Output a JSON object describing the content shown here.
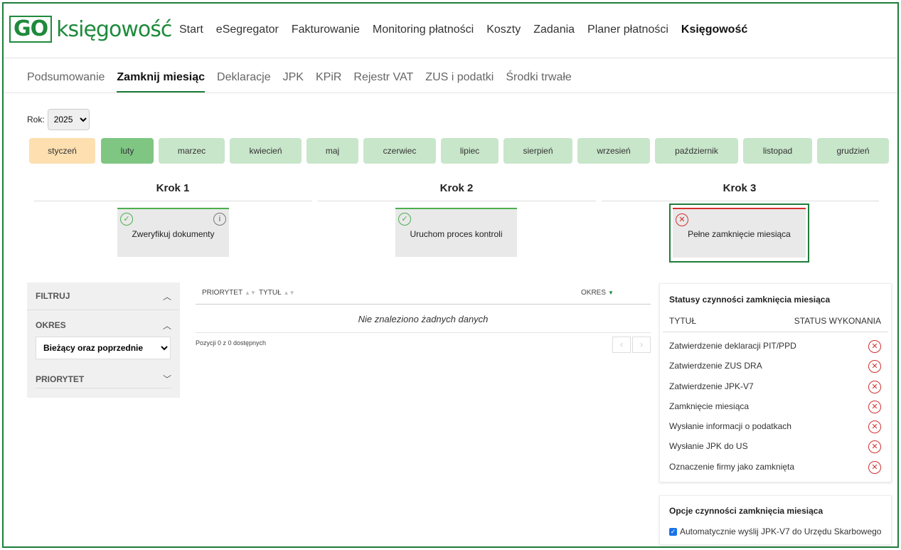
{
  "logo": {
    "box": "GO",
    "text": "księgowość"
  },
  "main_nav": [
    "Start",
    "eSegregator",
    "Fakturowanie",
    "Monitoring płatności",
    "Koszty",
    "Zadania",
    "Planer płatności",
    "Księgowość"
  ],
  "sub_nav": [
    "Podsumowanie",
    "Zamknij miesiąc",
    "Deklaracje",
    "JPK",
    "KPiR",
    "Rejestr VAT",
    "ZUS i podatki",
    "Środki trwałe"
  ],
  "year": {
    "label": "Rok:",
    "value": "2025"
  },
  "months": [
    "styczeń",
    "luty",
    "marzec",
    "kwiecień",
    "maj",
    "czerwiec",
    "lipiec",
    "sierpień",
    "wrzesień",
    "październik",
    "listopad",
    "grudzień"
  ],
  "colors": {
    "accent": "#1e7d3a",
    "month_current": "#7fc683",
    "month_past": "#fddfb0",
    "month_future": "#c8e6ca",
    "error": "#d32f2f"
  },
  "steps": [
    {
      "title": "Krok 1",
      "label": "Zweryfikuj dokumenty"
    },
    {
      "title": "Krok 2",
      "label": "Uruchom proces kontroli"
    },
    {
      "title": "Krok 3",
      "label": "Pełne zamknięcie miesiąca"
    }
  ],
  "filters": {
    "filter": "FILTRUJ",
    "period": "OKRES",
    "period_value": "Bieżący oraz poprzednie",
    "priority": "PRIORYTET"
  },
  "table": {
    "col_priority": "PRIORYTET",
    "col_title": "TYTUŁ",
    "col_period": "OKRES",
    "empty": "Nie znaleziono żadnych danych",
    "positions": "Pozycji 0 z 0 dostępnych"
  },
  "status_panel": {
    "title": "Statusy czynności zamknięcia miesiąca",
    "col_title": "TYTUŁ",
    "col_status": "STATUS WYKONANIA",
    "rows": [
      "Zatwierdzenie deklaracji PIT/PPD",
      "Zatwierdzenie ZUS DRA",
      "Zatwierdzenie JPK-V7",
      "Zamknięcie miesiąca",
      "Wysłanie informacji o podatkach",
      "Wysłanie JPK do US",
      "Oznaczenie firmy jako zamknięta"
    ]
  },
  "options_panel": {
    "title": "Opcje czynności zamknięcia miesiąca",
    "checkbox_label": "Automatycznie wyślij JPK-V7 do Urzędu Skarbowego"
  }
}
